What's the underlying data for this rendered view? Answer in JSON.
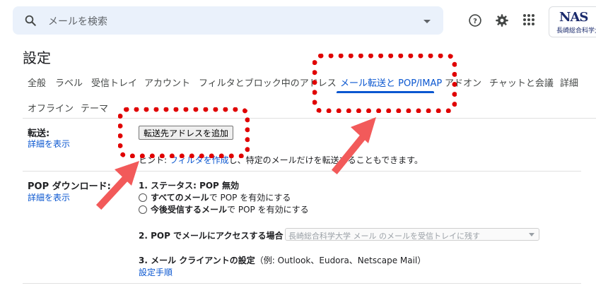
{
  "search": {
    "placeholder": "メールを検索"
  },
  "page_title": "設定",
  "tabs": [
    {
      "label": "全般"
    },
    {
      "label": "ラベル"
    },
    {
      "label": "受信トレイ"
    },
    {
      "label": "アカウント"
    },
    {
      "label": "フィルタとブロック中のアドレス"
    },
    {
      "label": "メール転送と POP/IMAP"
    },
    {
      "label": "アドオン"
    },
    {
      "label": "チャットと会議"
    },
    {
      "label": "詳細"
    },
    {
      "label": "オフライン"
    },
    {
      "label": "テーマ"
    }
  ],
  "forwarding": {
    "label": "転送:",
    "details_link": "詳細を表示",
    "add_button": "転送先アドレスを追加",
    "hint_prefix": "ヒント: ",
    "hint_link": "フィルタを作成",
    "hint_suffix": "し、特定のメールだけを転送することもできます。"
  },
  "pop": {
    "label": "POP ダウンロード:",
    "details_link": "詳細を表示",
    "status": "1. ステータス: POP 無効",
    "option1_bold": "すべてのメール",
    "option1_rest": "で POP を有効にする",
    "option2_bold": "今後受信するメール",
    "option2_rest": "で POP を有効にする",
    "access_label": "2. POP でメールにアクセスする場合",
    "access_select": "長崎総合科学大学 メール のメールを受信トレイに残す",
    "client_label": "3. メール クライアントの設定",
    "client_example": "（例: Outlook、Eudora、Netscape Mail）",
    "setup_link": "設定手順"
  },
  "logo": {
    "text": "NAS",
    "subtext": "長崎総合科学大学"
  },
  "colors": {
    "accent": "#0b57d0",
    "highlight": "#e00000",
    "arrow": "#f25a5a"
  }
}
